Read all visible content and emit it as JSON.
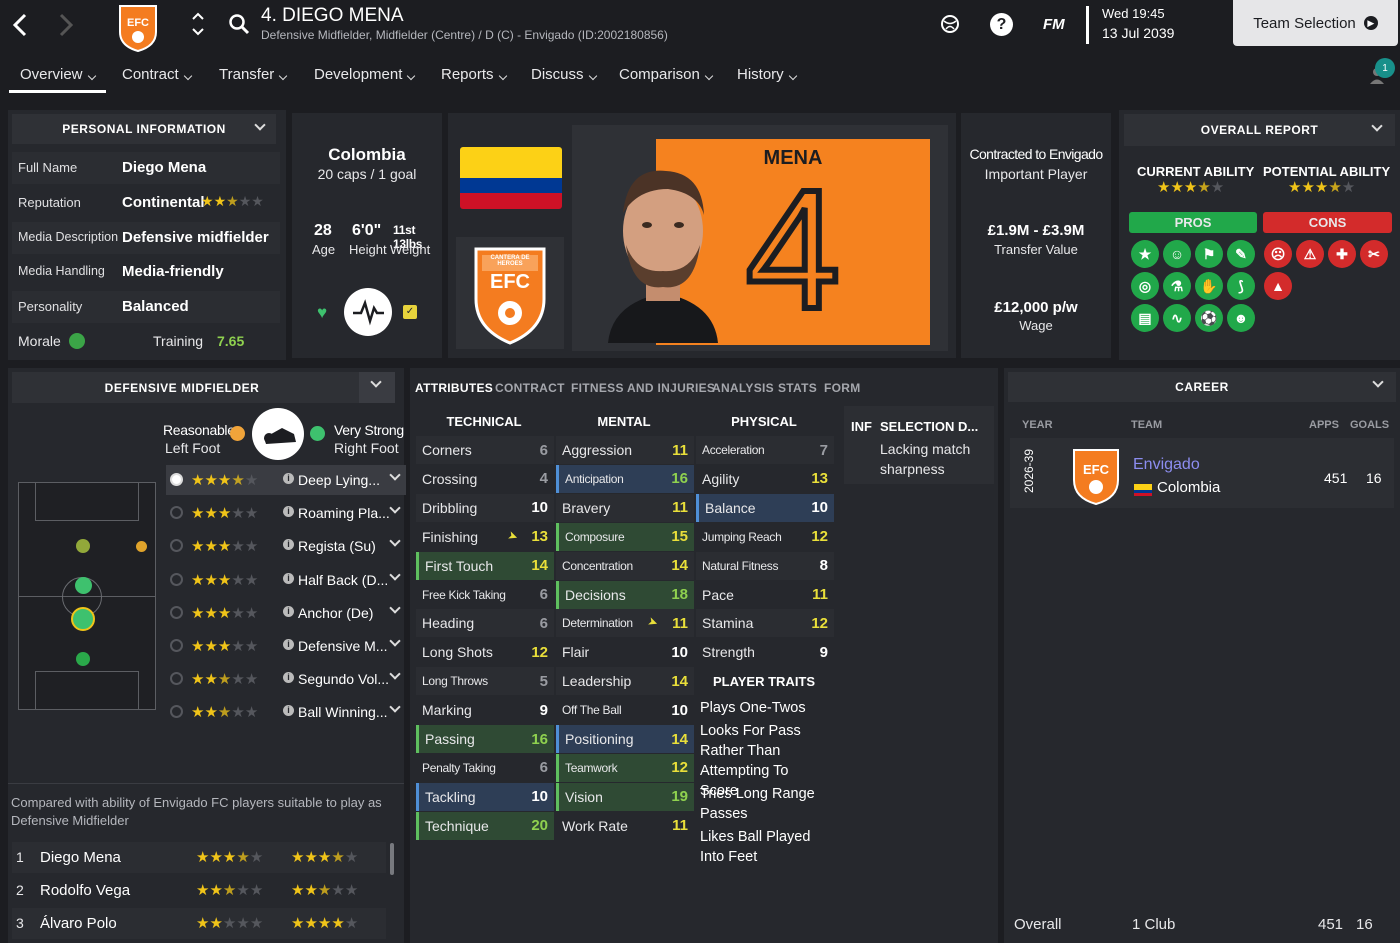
{
  "header": {
    "title": "4. DIEGO MENA",
    "subtitle": "Defensive Midfielder, Midfielder (Centre) / D (C) - Envigado (ID:2002180856)",
    "fm": "FM",
    "day_time": "Wed 19:45",
    "date": "13 Jul 2039",
    "team_selection": "Team Selection",
    "notif": "1"
  },
  "nav": [
    "Overview",
    "Contract",
    "Transfer",
    "Development",
    "Reports",
    "Discuss",
    "Comparison",
    "History"
  ],
  "personal": {
    "title": "PERSONAL INFORMATION",
    "rows": [
      {
        "label": "Full Name",
        "value": "Diego Mena"
      },
      {
        "label": "Reputation",
        "value": "Continental"
      },
      {
        "label": "Media Description",
        "value": "Defensive midfielder"
      },
      {
        "label": "Media Handling",
        "value": "Media-friendly"
      },
      {
        "label": "Personality",
        "value": "Balanced"
      }
    ],
    "morale_label": "Morale",
    "training_label": "Training",
    "training_value": "7.65"
  },
  "nation": {
    "country": "Colombia",
    "caps": "20 caps / 1 goal",
    "age": "28",
    "age_label": "Age",
    "height": "6'0\"",
    "height_label": "Height",
    "weight": "11st 13lbs",
    "weight_label": "Weight"
  },
  "kit": {
    "name": "MENA",
    "number": "4",
    "badge_text": "EFC",
    "badge_ring": "CANTERA DE HEROES"
  },
  "contract": {
    "status": "Contracted to Envigado",
    "role": "Important Player",
    "value": "£1.9M - £3.9M",
    "value_label": "Transfer Value",
    "wage": "£12,000 p/w",
    "wage_label": "Wage"
  },
  "report": {
    "title": "OVERALL REPORT",
    "ca": "CURRENT ABILITY",
    "pa": "POTENTIAL ABILITY",
    "pros": "PROS",
    "cons": "CONS",
    "pro_icons": [
      "star-icon",
      "brain-icon",
      "flag-icon",
      "wrench-icon",
      "target-icon",
      "flask-icon",
      "handshake-icon",
      "whistle-icon",
      "clipboard-icon",
      "wave-icon",
      "boots-icon",
      "head-icon"
    ],
    "con_icons": [
      "mask-icon",
      "shoe-icon",
      "medical-cross-icon",
      "scissors-icon",
      "cone-icon"
    ]
  },
  "position": {
    "title": "DEFENSIVE MIDFIELDER",
    "left_foot": "Left Foot",
    "left_foot_level": "Reasonable",
    "right_foot": "Right Foot",
    "right_foot_level": "Very Strong",
    "roles": [
      {
        "name": "Deep Lying...",
        "stars": 3.5
      },
      {
        "name": "Roaming Pla...",
        "stars": 3
      },
      {
        "name": "Regista (Su)",
        "stars": 3
      },
      {
        "name": "Half Back (D...",
        "stars": 3
      },
      {
        "name": "Anchor (De)",
        "stars": 3
      },
      {
        "name": "Defensive M...",
        "stars": 3
      },
      {
        "name": "Segundo Vol...",
        "stars": 2.5
      },
      {
        "name": "Ball Winning...",
        "stars": 2.5
      }
    ],
    "compare_text": "Compared with ability of Envigado FC players suitable to play as Defensive Midfielder",
    "compare": [
      {
        "rank": "1",
        "name": "Diego Mena",
        "ca": 3.5,
        "pa": 3.5
      },
      {
        "rank": "2",
        "name": "Rodolfo Vega",
        "ca": 2.5,
        "pa": 2.5
      },
      {
        "rank": "3",
        "name": "Álvaro Polo",
        "ca": 2,
        "pa": 4
      }
    ]
  },
  "tabs": [
    "ATTRIBUTES",
    "CONTRACT",
    "FITNESS AND INJURIES",
    "ANALYSIS",
    "STATS",
    "FORM"
  ],
  "technical": {
    "title": "TECHNICAL",
    "items": [
      [
        "Corners",
        "6"
      ],
      [
        "Crossing",
        "4"
      ],
      [
        "Dribbling",
        "10"
      ],
      [
        "Finishing",
        "13"
      ],
      [
        "First Touch",
        "14"
      ],
      [
        "Free Kick Taking",
        "6"
      ],
      [
        "Heading",
        "6"
      ],
      [
        "Long Shots",
        "12"
      ],
      [
        "Long Throws",
        "5"
      ],
      [
        "Marking",
        "9"
      ],
      [
        "Passing",
        "16"
      ],
      [
        "Penalty Taking",
        "6"
      ],
      [
        "Tackling",
        "10"
      ],
      [
        "Technique",
        "20"
      ]
    ]
  },
  "mental": {
    "title": "MENTAL",
    "items": [
      [
        "Aggression",
        "11"
      ],
      [
        "Anticipation",
        "16"
      ],
      [
        "Bravery",
        "11"
      ],
      [
        "Composure",
        "15"
      ],
      [
        "Concentration",
        "14"
      ],
      [
        "Decisions",
        "18"
      ],
      [
        "Determination",
        "11"
      ],
      [
        "Flair",
        "10"
      ],
      [
        "Leadership",
        "14"
      ],
      [
        "Off The Ball",
        "10"
      ],
      [
        "Positioning",
        "14"
      ],
      [
        "Teamwork",
        "12"
      ],
      [
        "Vision",
        "19"
      ],
      [
        "Work Rate",
        "11"
      ]
    ]
  },
  "physical": {
    "title": "PHYSICAL",
    "items": [
      [
        "Acceleration",
        "7"
      ],
      [
        "Agility",
        "13"
      ],
      [
        "Balance",
        "10"
      ],
      [
        "Jumping Reach",
        "12"
      ],
      [
        "Natural Fitness",
        "8"
      ],
      [
        "Pace",
        "11"
      ],
      [
        "Stamina",
        "12"
      ],
      [
        "Strength",
        "9"
      ]
    ]
  },
  "traits": {
    "title": "PLAYER TRAITS",
    "items": [
      "Plays One-Twos",
      "Looks For Pass Rather Than Attempting To Score",
      "Tries Long Range Passes",
      "Likes Ball Played Into Feet"
    ]
  },
  "selection": {
    "inf": "INF",
    "title": "SELECTION D...",
    "text": "Lacking match sharpness"
  },
  "career": {
    "title": "CAREER",
    "col_year": "YEAR",
    "col_team": "TEAM",
    "col_apps": "APPS",
    "col_goals": "GOALS",
    "row": {
      "year": "2026-39",
      "team": "Envigado",
      "nation": "Colombia",
      "apps": "451",
      "goals": "16"
    },
    "total": {
      "label": "Overall",
      "clubs": "1 Club",
      "apps": "451",
      "goals": "16"
    }
  }
}
